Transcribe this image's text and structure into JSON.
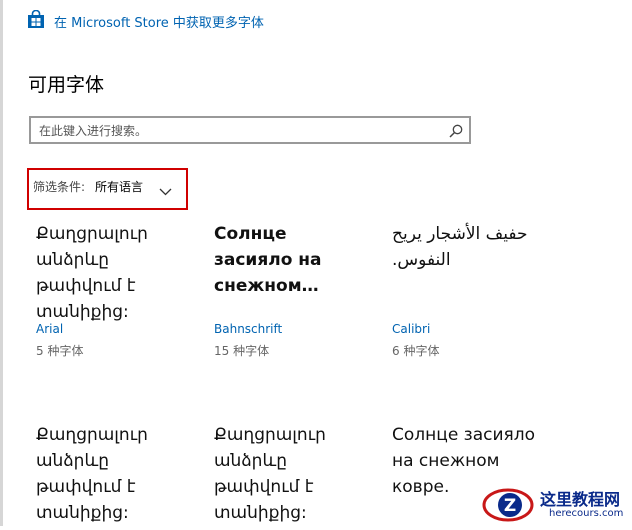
{
  "store_link": {
    "label": "在 Microsoft Store 中获取更多字体",
    "icon": "store-bag-icon"
  },
  "page_title": "可用字体",
  "search": {
    "placeholder": "在此键入进行搜索。",
    "icon": "search-icon"
  },
  "filter": {
    "label": "筛选条件:",
    "value": "所有语言",
    "icon": "chevron-down-icon"
  },
  "fonts": [
    {
      "sample": "Քաղցրալուր\nանձրևը\nթափվում է\nտանիքից:",
      "name": "Arial",
      "count": "5 种字体"
    },
    {
      "sample": "Солнце\nзасияло на\nснежном…",
      "name": "Bahnschrift",
      "count": "15 种字体"
    },
    {
      "sample": "حفيف الأشجار يريح\nالنفوس.",
      "name": "Calibri",
      "count": "6 种字体"
    },
    {
      "sample": "Քաղցրալուր\nանձրևը\nթափվում է\nտանիքից:"
    },
    {
      "sample": "Քաղցրալուր\nանձրևը\nթափվում է\nտանիքից:"
    },
    {
      "sample": "Солнце засияло\nна снежном\nковре."
    }
  ],
  "watermark": {
    "line1": "这里教程网",
    "line2": "herecours.com",
    "logo_letter": "Z"
  },
  "colors": {
    "link": "#0063b1",
    "highlight_border": "#d00000",
    "watermark": "#0a2a8a"
  }
}
